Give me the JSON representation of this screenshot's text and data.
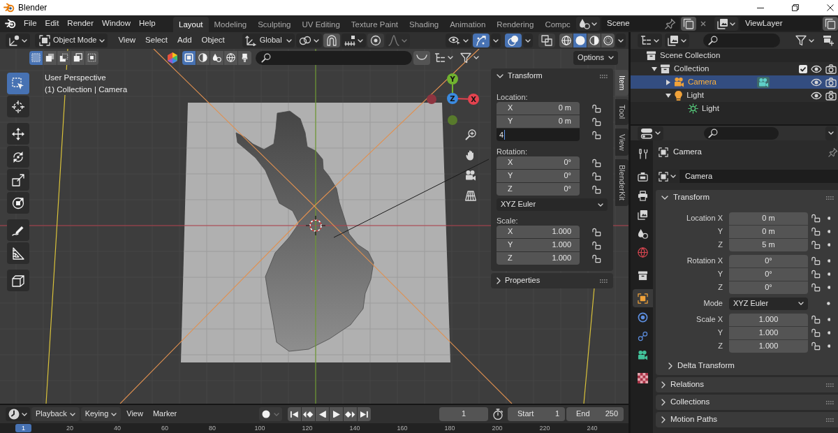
{
  "window": {
    "title": "Blender"
  },
  "top_bar": {
    "menus": [
      "File",
      "Edit",
      "Render",
      "Window",
      "Help"
    ],
    "workspaces": [
      {
        "label": "Layout",
        "selected": true
      },
      {
        "label": "Modeling",
        "selected": false
      },
      {
        "label": "Sculpting",
        "selected": false
      },
      {
        "label": "UV Editing",
        "selected": false
      },
      {
        "label": "Texture Paint",
        "selected": false
      },
      {
        "label": "Shading",
        "selected": false
      },
      {
        "label": "Animation",
        "selected": false
      },
      {
        "label": "Rendering",
        "selected": false
      },
      {
        "label": "Compc",
        "selected": false
      }
    ],
    "scene": "Scene",
    "view_layer": "ViewLayer"
  },
  "viewport": {
    "header": {
      "mode": "Object Mode",
      "menus": [
        "View",
        "Select",
        "Add",
        "Object"
      ],
      "orientation": "Global",
      "proportional_editing": {
        "on": false
      },
      "gizmos": {
        "on": true
      },
      "overlays": {
        "on": true
      },
      "xray": {
        "on": false
      },
      "shading": [
        {
          "selected": false
        },
        {
          "selected": true
        },
        {
          "selected": false
        },
        {
          "selected": false
        }
      ]
    },
    "tool_settings": {
      "selection_modes": [
        {
          "selected": true
        },
        {
          "selected": false
        },
        {
          "selected": false
        },
        {
          "selected": false
        },
        {
          "selected": false
        }
      ],
      "asset_types": [
        {
          "selected": true
        },
        {
          "selected": false
        },
        {
          "selected": false
        },
        {
          "selected": false
        },
        {
          "selected": false
        }
      ],
      "options": "Options"
    },
    "tools": [
      {
        "selected": true
      },
      {
        "selected": false
      },
      {
        "selected": false
      },
      {
        "selected": false
      },
      {
        "selected": false
      },
      {
        "selected": false
      },
      {
        "selected": false
      },
      {
        "selected": false
      },
      {
        "selected": false
      }
    ],
    "info": [
      "User Perspective",
      "(1) Collection | Camera"
    ],
    "gizmo": [
      {
        "kind": "positive",
        "label": "Y",
        "color": "#70b22f"
      },
      {
        "kind": "positive",
        "label": "Z",
        "color": "#3b8be0"
      },
      {
        "kind": "positive",
        "label": "X",
        "color": "#e4434f"
      },
      {
        "kind": "negative",
        "color": "#8e3440"
      },
      {
        "kind": "negative",
        "color": "#587a2c"
      }
    ],
    "sidebar": {
      "tabs": [
        {
          "label": "Item",
          "selected": true
        },
        {
          "label": "Tool",
          "selected": false
        },
        {
          "label": "View",
          "selected": false
        },
        {
          "label": "BlenderKit",
          "selected": false
        }
      ],
      "panels": [
        {
          "title": "Transform",
          "expanded": true,
          "sections": [
            {
              "kind": "vector",
              "label": "Location:",
              "fields": [
                {
                  "kind": "number",
                  "axis": "X",
                  "value": "0 m",
                  "locked": false
                },
                {
                  "kind": "number",
                  "axis": "Y",
                  "value": "0 m",
                  "locked": false
                },
                {
                  "kind": "editing",
                  "value": "4",
                  "locked": false
                }
              ]
            },
            {
              "kind": "vector",
              "label": "Rotation:",
              "fields": [
                {
                  "kind": "number",
                  "axis": "X",
                  "value": "0°",
                  "locked": false
                },
                {
                  "kind": "number",
                  "axis": "Y",
                  "value": "0°",
                  "locked": false
                },
                {
                  "kind": "number",
                  "axis": "Z",
                  "value": "0°",
                  "locked": false
                }
              ]
            },
            {
              "kind": "dropdown",
              "value": "XYZ Euler"
            },
            {
              "kind": "vector",
              "label": "Scale:",
              "fields": [
                {
                  "kind": "number",
                  "axis": "X",
                  "value": "1.000",
                  "locked": false
                },
                {
                  "kind": "number",
                  "axis": "Y",
                  "value": "1.000",
                  "locked": false
                },
                {
                  "kind": "number",
                  "axis": "Z",
                  "value": "1.000",
                  "locked": false
                }
              ]
            }
          ]
        },
        {
          "title": "Properties",
          "expanded": false
        }
      ]
    }
  },
  "outliner": {
    "tree": [
      {
        "label": "Scene Collection",
        "kind": "scene_collection",
        "selected": false,
        "children": [
          {
            "label": "Collection",
            "kind": "collection",
            "selected": false,
            "expanded": true,
            "checked": true,
            "children": [
              {
                "label": "Camera",
                "kind": "camera",
                "selected": true,
                "expanded": false
              },
              {
                "label": "Light",
                "kind": "light",
                "selected": false,
                "expanded": true,
                "children": [
                  {
                    "label": "Light",
                    "kind": "light_data",
                    "selected": false
                  }
                ]
              }
            ]
          }
        ]
      }
    ]
  },
  "properties": {
    "tabs": [
      {
        "selected": false
      },
      {
        "selected": false
      },
      {
        "selected": false
      },
      {
        "selected": false
      },
      {
        "selected": false
      },
      {
        "selected": false
      },
      {
        "selected": false
      },
      {
        "selected": true
      },
      {
        "selected": false
      },
      {
        "selected": false
      },
      {
        "selected": false
      },
      {
        "selected": false
      }
    ],
    "context": "Camera",
    "name": "Camera",
    "panels": [
      {
        "title": "Transform",
        "expanded": true,
        "groups": [
          {
            "rows": [
              {
                "label": "Location X",
                "kind": "number",
                "value": "0 m",
                "locked": false
              },
              {
                "label": "Y",
                "kind": "number",
                "value": "0 m",
                "locked": false
              },
              {
                "label": "Z",
                "kind": "number",
                "value": "5 m",
                "locked": false
              }
            ]
          },
          {
            "rows": [
              {
                "label": "Rotation X",
                "kind": "number",
                "value": "0°",
                "locked": false
              },
              {
                "label": "Y",
                "kind": "number",
                "value": "0°",
                "locked": false
              },
              {
                "label": "Z",
                "kind": "number",
                "value": "0°",
                "locked": false
              }
            ]
          },
          {
            "rows": [
              {
                "label": "Mode",
                "kind": "dropdown",
                "value": "XYZ Euler"
              }
            ]
          },
          {
            "rows": [
              {
                "label": "Scale X",
                "kind": "number",
                "value": "1.000",
                "locked": false
              },
              {
                "label": "Y",
                "kind": "number",
                "value": "1.000",
                "locked": false
              },
              {
                "label": "Z",
                "kind": "number",
                "value": "1.000",
                "locked": false
              }
            ]
          }
        ],
        "subpanels": [
          {
            "title": "Delta Transform",
            "expanded": false
          }
        ]
      },
      {
        "title": "Relations",
        "expanded": false
      },
      {
        "title": "Collections",
        "expanded": false
      },
      {
        "title": "Motion Paths",
        "expanded": false
      }
    ]
  },
  "timeline": {
    "menus": [
      {
        "label": "Playback",
        "kind": "dropdown"
      },
      {
        "label": "Keying",
        "kind": "dropdown"
      },
      {
        "label": "View",
        "kind": "menu"
      },
      {
        "label": "Marker",
        "kind": "menu"
      }
    ],
    "auto_keying": {
      "on": false
    },
    "current_frame": "1",
    "start": {
      "label": "Start",
      "value": "1"
    },
    "end": {
      "label": "End",
      "value": "250"
    },
    "ruler": {
      "current": "1",
      "ticks": [
        "20",
        "40",
        "60",
        "80",
        "100",
        "120",
        "140",
        "160",
        "180",
        "200",
        "220",
        "240"
      ]
    }
  }
}
